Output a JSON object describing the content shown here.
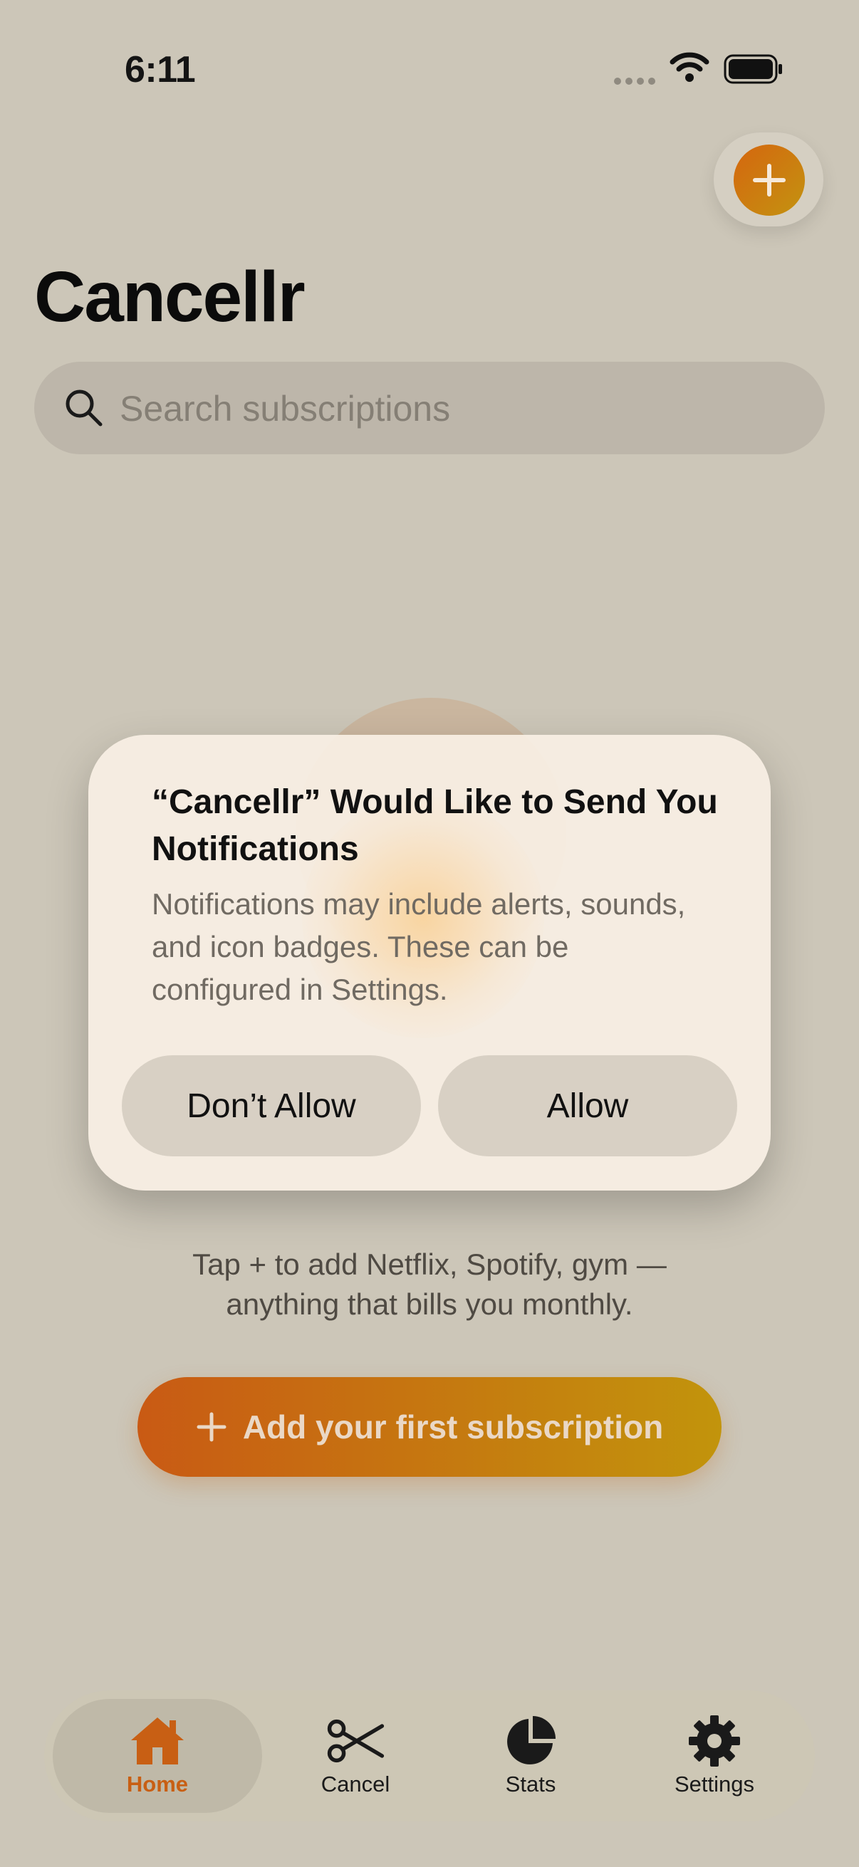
{
  "status_bar": {
    "time": "6:11"
  },
  "header": {
    "title": "Cancellr"
  },
  "search": {
    "placeholder": "Search subscriptions"
  },
  "empty_state": {
    "description_line1": "Tap + to add Netflix, Spotify, gym —",
    "description_line2": "anything that bills you monthly.",
    "cta_label": "Add your first subscription"
  },
  "dialog": {
    "title": "“Cancellr” Would Like to Send You Notifications",
    "message": "Notifications may include alerts, sounds, and icon badges. These can be configured in Settings.",
    "deny_label": "Don’t Allow",
    "allow_label": "Allow"
  },
  "tab_bar": {
    "items": [
      {
        "label": "Home",
        "icon": "house-icon",
        "active": true
      },
      {
        "label": "Cancel",
        "icon": "scissors-icon",
        "active": false
      },
      {
        "label": "Stats",
        "icon": "pie-chart-icon",
        "active": false
      },
      {
        "label": "Settings",
        "icon": "gear-icon",
        "active": false
      }
    ]
  },
  "colors": {
    "accent": "#c85f14",
    "accent_end": "#c2940c",
    "background": "#ccc6b8"
  }
}
